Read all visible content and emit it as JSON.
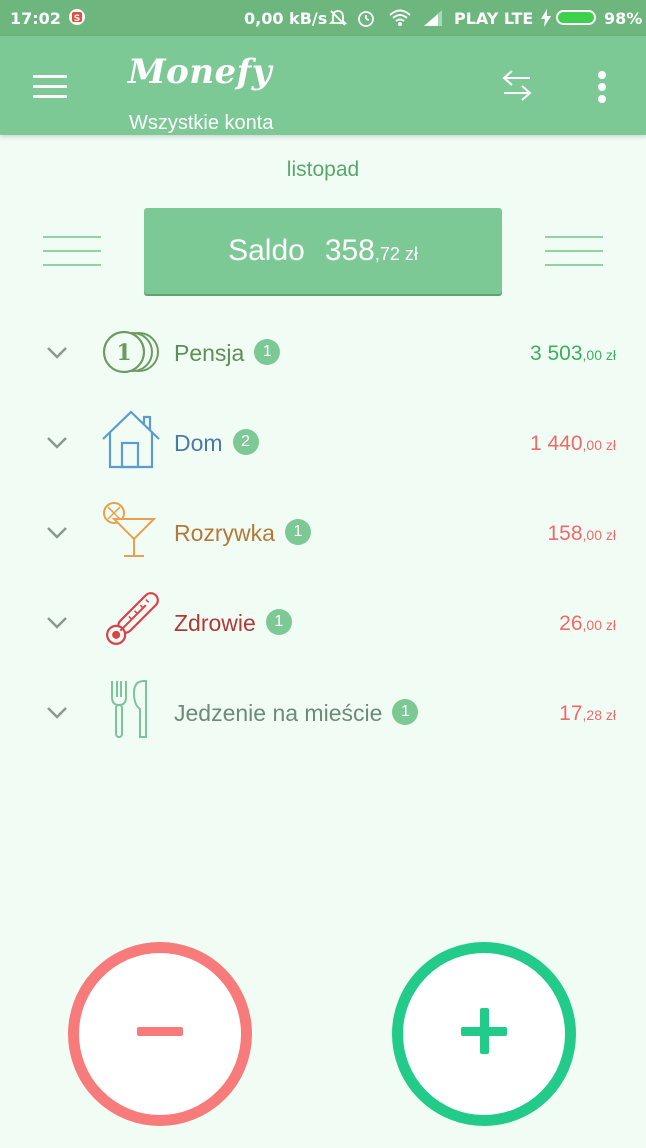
{
  "status_bar": {
    "time": "17:02",
    "speed": "0,00 kB/s",
    "carrier": "PLAY LTE",
    "battery": "98%"
  },
  "app_bar": {
    "title": "Monefy",
    "subtitle": "Wszystkie konta"
  },
  "month": "listopad",
  "balance": {
    "label": "Saldo",
    "integer": "358",
    "decimal": ",72 zł"
  },
  "categories": [
    {
      "name": "Pensja",
      "count": "1",
      "amount_int": "3 503",
      "amount_dec": ",00 zł",
      "icon": "coins-icon",
      "name_color": "#5e8f58",
      "amount_color": "#3dae5f"
    },
    {
      "name": "Dom",
      "count": "2",
      "amount_int": "1 440",
      "amount_dec": ",00 zł",
      "icon": "house-icon",
      "name_color": "#4a7aa6",
      "amount_color": "#f06a6a"
    },
    {
      "name": "Rozrywka",
      "count": "1",
      "amount_int": "158",
      "amount_dec": ",00 zł",
      "icon": "cocktail-icon",
      "name_color": "#b4793a",
      "amount_color": "#f06a6a"
    },
    {
      "name": "Zdrowie",
      "count": "1",
      "amount_int": "26",
      "amount_dec": ",00 zł",
      "icon": "thermometer-icon",
      "name_color": "#b03a3a",
      "amount_color": "#f06a6a"
    },
    {
      "name": "Jedzenie na mieście",
      "count": "1",
      "amount_int": "17",
      "amount_dec": ",28 zł",
      "icon": "cutlery-icon",
      "name_color": "#6e8a78",
      "amount_color": "#f06a6a"
    }
  ],
  "colors": {
    "primary": "#7dc996",
    "status_bar": "#6db77f",
    "background": "#f1fdf4",
    "expense": "#f87b7b",
    "income": "#23cb8b"
  }
}
